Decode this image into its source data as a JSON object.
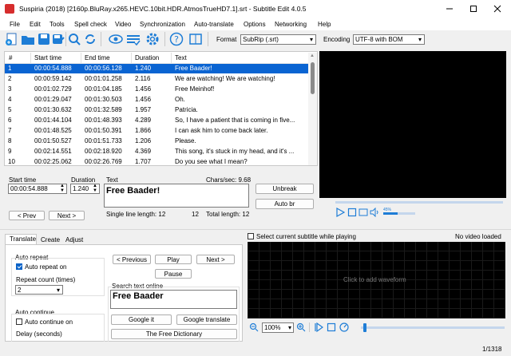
{
  "window": {
    "title": "Suspiria (2018) [2160p.BluRay.x265.HEVC.10bit.HDR.AtmosTrueHD7.1].srt - Subtitle Edit 4.0.5",
    "app_icon": "subtitle-edit-icon",
    "controls": [
      "minimize-icon",
      "maximize-icon",
      "close-icon"
    ]
  },
  "menu": [
    "File",
    "Edit",
    "Tools",
    "Spell check",
    "Video",
    "Synchronization",
    "Auto-translate",
    "Options",
    "Networking",
    "Help"
  ],
  "toolbar": {
    "format_label": "Format",
    "format_value": "SubRip (.srt)",
    "encoding_label": "Encoding",
    "encoding_value": "UTF-8 with BOM"
  },
  "table": {
    "columns": [
      "#",
      "Start time",
      "End time",
      "Duration",
      "Text"
    ],
    "rows": [
      {
        "n": "1",
        "start": "00:00:54.888",
        "end": "00:00:56.128",
        "dur": "1.240",
        "text": "Free Baader!"
      },
      {
        "n": "2",
        "start": "00:00:59.142",
        "end": "00:01:01.258",
        "dur": "2.116",
        "text": "We are watching! We are watching!"
      },
      {
        "n": "3",
        "start": "00:01:02.729",
        "end": "00:01:04.185",
        "dur": "1.456",
        "text": "Free Meinhof!"
      },
      {
        "n": "4",
        "start": "00:01:29.047",
        "end": "00:01:30.503",
        "dur": "1.456",
        "text": "Oh."
      },
      {
        "n": "5",
        "start": "00:01:30.632",
        "end": "00:01:32.589",
        "dur": "1.957",
        "text": "Patricia."
      },
      {
        "n": "6",
        "start": "00:01:44.104",
        "end": "00:01:48.393",
        "dur": "4.289",
        "text": "So, I have a patient that is coming in five..."
      },
      {
        "n": "7",
        "start": "00:01:48.525",
        "end": "00:01:50.391",
        "dur": "1.866",
        "text": "I can ask him to come back later."
      },
      {
        "n": "8",
        "start": "00:01:50.527",
        "end": "00:01:51.733",
        "dur": "1.206",
        "text": "Please."
      },
      {
        "n": "9",
        "start": "00:02:14.551",
        "end": "00:02:18.920",
        "dur": "4.369",
        "text": "This song, it's stuck in my head, and it's ..."
      },
      {
        "n": "10",
        "start": "00:02:25.062",
        "end": "00:02:26.769",
        "dur": "1.707",
        "text": "Do you see what I mean?"
      }
    ]
  },
  "editor": {
    "start_label": "Start time",
    "start_value": "00:00:54.888",
    "duration_label": "Duration",
    "duration_value": "1.240",
    "text_label": "Text",
    "chars_sec": "Chars/sec: 9.68",
    "text_value": "Free Baader!",
    "unbreak": "Unbreak",
    "auto_br": "Auto br",
    "prev": "< Prev",
    "next": "Next >",
    "single_line": "Single line length: 12",
    "line_len": "12",
    "total_len": "Total length: 12"
  },
  "video": {
    "volume_label": "45%"
  },
  "tabs": [
    "Translate",
    "Create",
    "Adjust"
  ],
  "translate": {
    "auto_repeat_title": "Auto repeat",
    "auto_repeat_on": "Auto repeat on",
    "repeat_count_label": "Repeat count (times)",
    "repeat_count_value": "2",
    "auto_continue_title": "Auto continue",
    "auto_continue_on": "Auto continue on",
    "delay_label": "Delay (seconds)",
    "prev_btn": "< Previous",
    "play_btn": "Play",
    "next_btn": "Next >",
    "pause_btn": "Pause",
    "search_label": "Search text online",
    "search_value": "Free Baader",
    "google_it": "Google it",
    "google_translate": "Google translate",
    "free_dictionary": "The Free Dictionary"
  },
  "waveform": {
    "select_current": "Select current subtitle while playing",
    "no_video": "No video loaded",
    "click_hint": "Click to add waveform",
    "zoom": "100%"
  },
  "status": {
    "position": "1/1318"
  }
}
